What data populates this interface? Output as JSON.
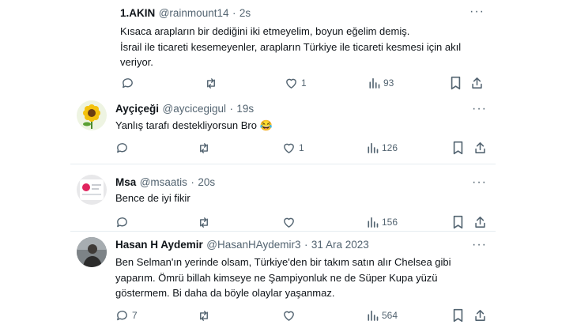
{
  "tweets": [
    {
      "name": "1.AKIN",
      "handle": "@rainmount14",
      "time": "2s",
      "lines": [
        "Kısaca arapların bir dediğini iki etmeyelim, boyun eğelim demiş.",
        "İsrail ile ticareti kesemeyenler, arapların Türkiye ile ticareti kesmesi için akıl",
        "veriyor."
      ],
      "replies": "",
      "retweets": "",
      "likes": "1",
      "views": "93"
    },
    {
      "name": "Ayçiçeği",
      "handle": "@aycicegigul",
      "time": "19s",
      "lines": [
        "Yanlış tarafı destekliyorsun Bro 😂"
      ],
      "replies": "",
      "retweets": "",
      "likes": "1",
      "views": "126"
    },
    {
      "name": "Msa",
      "handle": "@msaatis",
      "time": "20s",
      "lines": [
        "Bence de iyi fikir"
      ],
      "replies": "",
      "retweets": "",
      "likes": "",
      "views": "156"
    },
    {
      "name": "Hasan H Aydemir",
      "handle": "@HasanHAydemir3",
      "time": "31 Ara 2023",
      "lines": [
        "Ben Selman'ın yerinde olsam, Türkiye'den bir takım satın alır Chelsea gibi",
        "yaparım. Ömrü billah kimseye ne Şampiyonluk ne de Süper Kupa yüzü",
        "göstermem. Bi daha da böyle olaylar yaşanmaz."
      ],
      "replies": "7",
      "retweets": "",
      "likes": "",
      "views": "564"
    }
  ],
  "separator": "·",
  "more_glyph": "···"
}
